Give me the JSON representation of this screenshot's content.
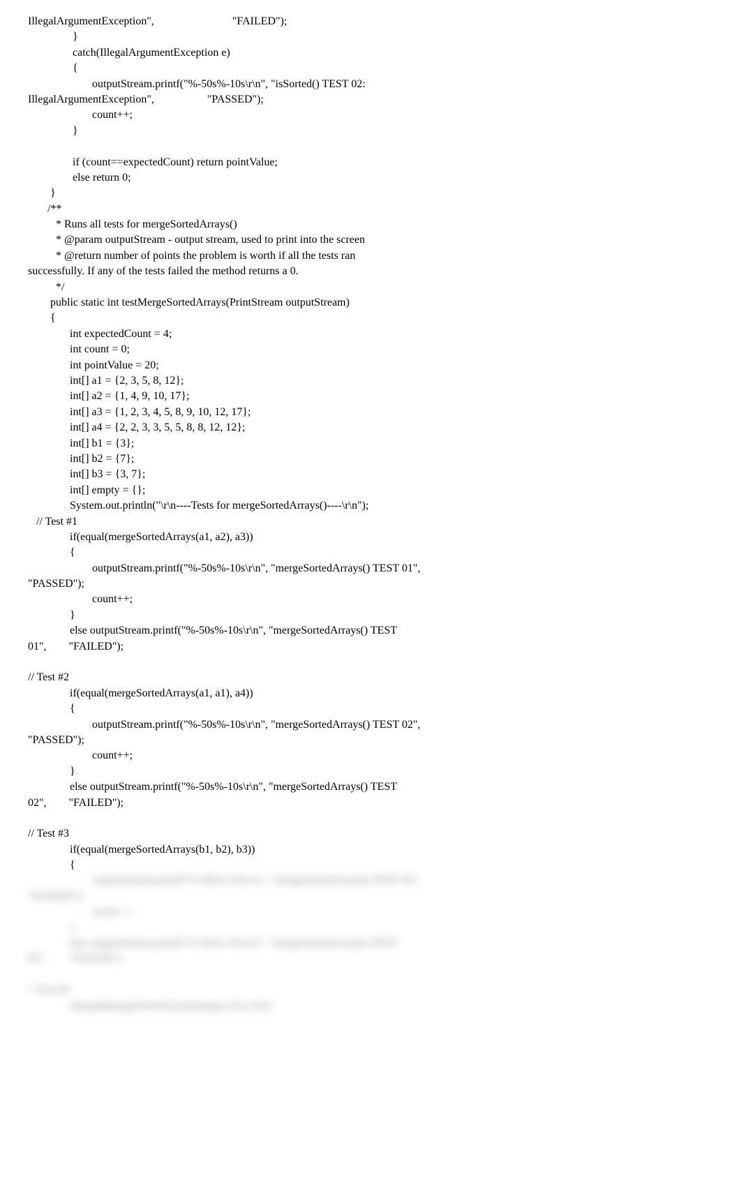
{
  "code": {
    "line1": "IllegalArgumentException\",                            \"FAILED\");",
    "line2": "                }",
    "line3": "                catch(IllegalArgumentException e)",
    "line4": "                {",
    "line5": "                       outputStream.printf(\"%-50s%-10s\\r\\n\", \"isSorted() TEST 02:",
    "line6": "IllegalArgumentException\",                   \"PASSED\");",
    "line7": "                       count++;",
    "line8": "                }",
    "line9": "",
    "line10": "                if (count==expectedCount) return pointValue;",
    "line11": "                else return 0;",
    "line12": "        }",
    "line13": "       /**",
    "line14": "          * Runs all tests for mergeSortedArrays()",
    "line15": "          * @param outputStream - output stream, used to print into the screen",
    "line16": "          * @return number of points the problem is worth if all the tests ran",
    "line17": "successfully. If any of the tests failed the method returns a 0.",
    "line18": "          */",
    "line19": "        public static int testMergeSortedArrays(PrintStream outputStream)",
    "line20": "        {",
    "line21": "               int expectedCount = 4;",
    "line22": "               int count = 0;",
    "line23": "               int pointValue = 20;",
    "line24": "               int[] a1 = {2, 3, 5, 8, 12};",
    "line25": "               int[] a2 = {1, 4, 9, 10, 17};",
    "line26": "               int[] a3 = {1, 2, 3, 4, 5, 8, 9, 10, 12, 17};",
    "line27": "               int[] a4 = {2, 2, 3, 3, 5, 5, 8, 8, 12, 12};",
    "line28": "               int[] b1 = {3};",
    "line29": "               int[] b2 = {7};",
    "line30": "               int[] b3 = {3, 7};",
    "line31": "               int[] empty = {};",
    "line32": "               System.out.println(\"\\r\\n----Tests for mergeSortedArrays()----\\r\\n\");",
    "line33": "   // Test #1",
    "line34": "               if(equal(mergeSortedArrays(a1, a2), a3))",
    "line35": "               {",
    "line36": "                       outputStream.printf(\"%-50s%-10s\\r\\n\", \"mergeSortedArrays() TEST 01\",",
    "line37": "\"PASSED\");",
    "line38": "                       count++;",
    "line39": "               }",
    "line40": "               else outputStream.printf(\"%-50s%-10s\\r\\n\", \"mergeSortedArrays() TEST",
    "line41": "01\",        \"FAILED\");",
    "line42": "",
    "line43": "// Test #2",
    "line44": "               if(equal(mergeSortedArrays(a1, a1), a4))",
    "line45": "               {",
    "line46": "                       outputStream.printf(\"%-50s%-10s\\r\\n\", \"mergeSortedArrays() TEST 02\",",
    "line47": "\"PASSED\");",
    "line48": "                       count++;",
    "line49": "               }",
    "line50": "               else outputStream.printf(\"%-50s%-10s\\r\\n\", \"mergeSortedArrays() TEST",
    "line51": "02\",        \"FAILED\");",
    "line52": "",
    "line53": "// Test #3",
    "line54": "               if(equal(mergeSortedArrays(b1, b2), b3))",
    "line55": "               {"
  },
  "blurred": {
    "line1": "                       outputStream.printf(\"%-50s%-10s\\r\\n\", \"mergeSortedArrays() TEST 03\",",
    "line2": "\"PASSED\");",
    "line3": "                       count++;",
    "line4": "               }",
    "line5": "               else outputStream.printf(\"%-50s%-10s\\r\\n\", \"mergeSortedArrays() TEST",
    "line6": "03\",        \"FAILED\");",
    "line7": "",
    "line8": "// Test #4",
    "line9": "               if(equal(mergeSortedArrays(empty, b1), b1))"
  }
}
